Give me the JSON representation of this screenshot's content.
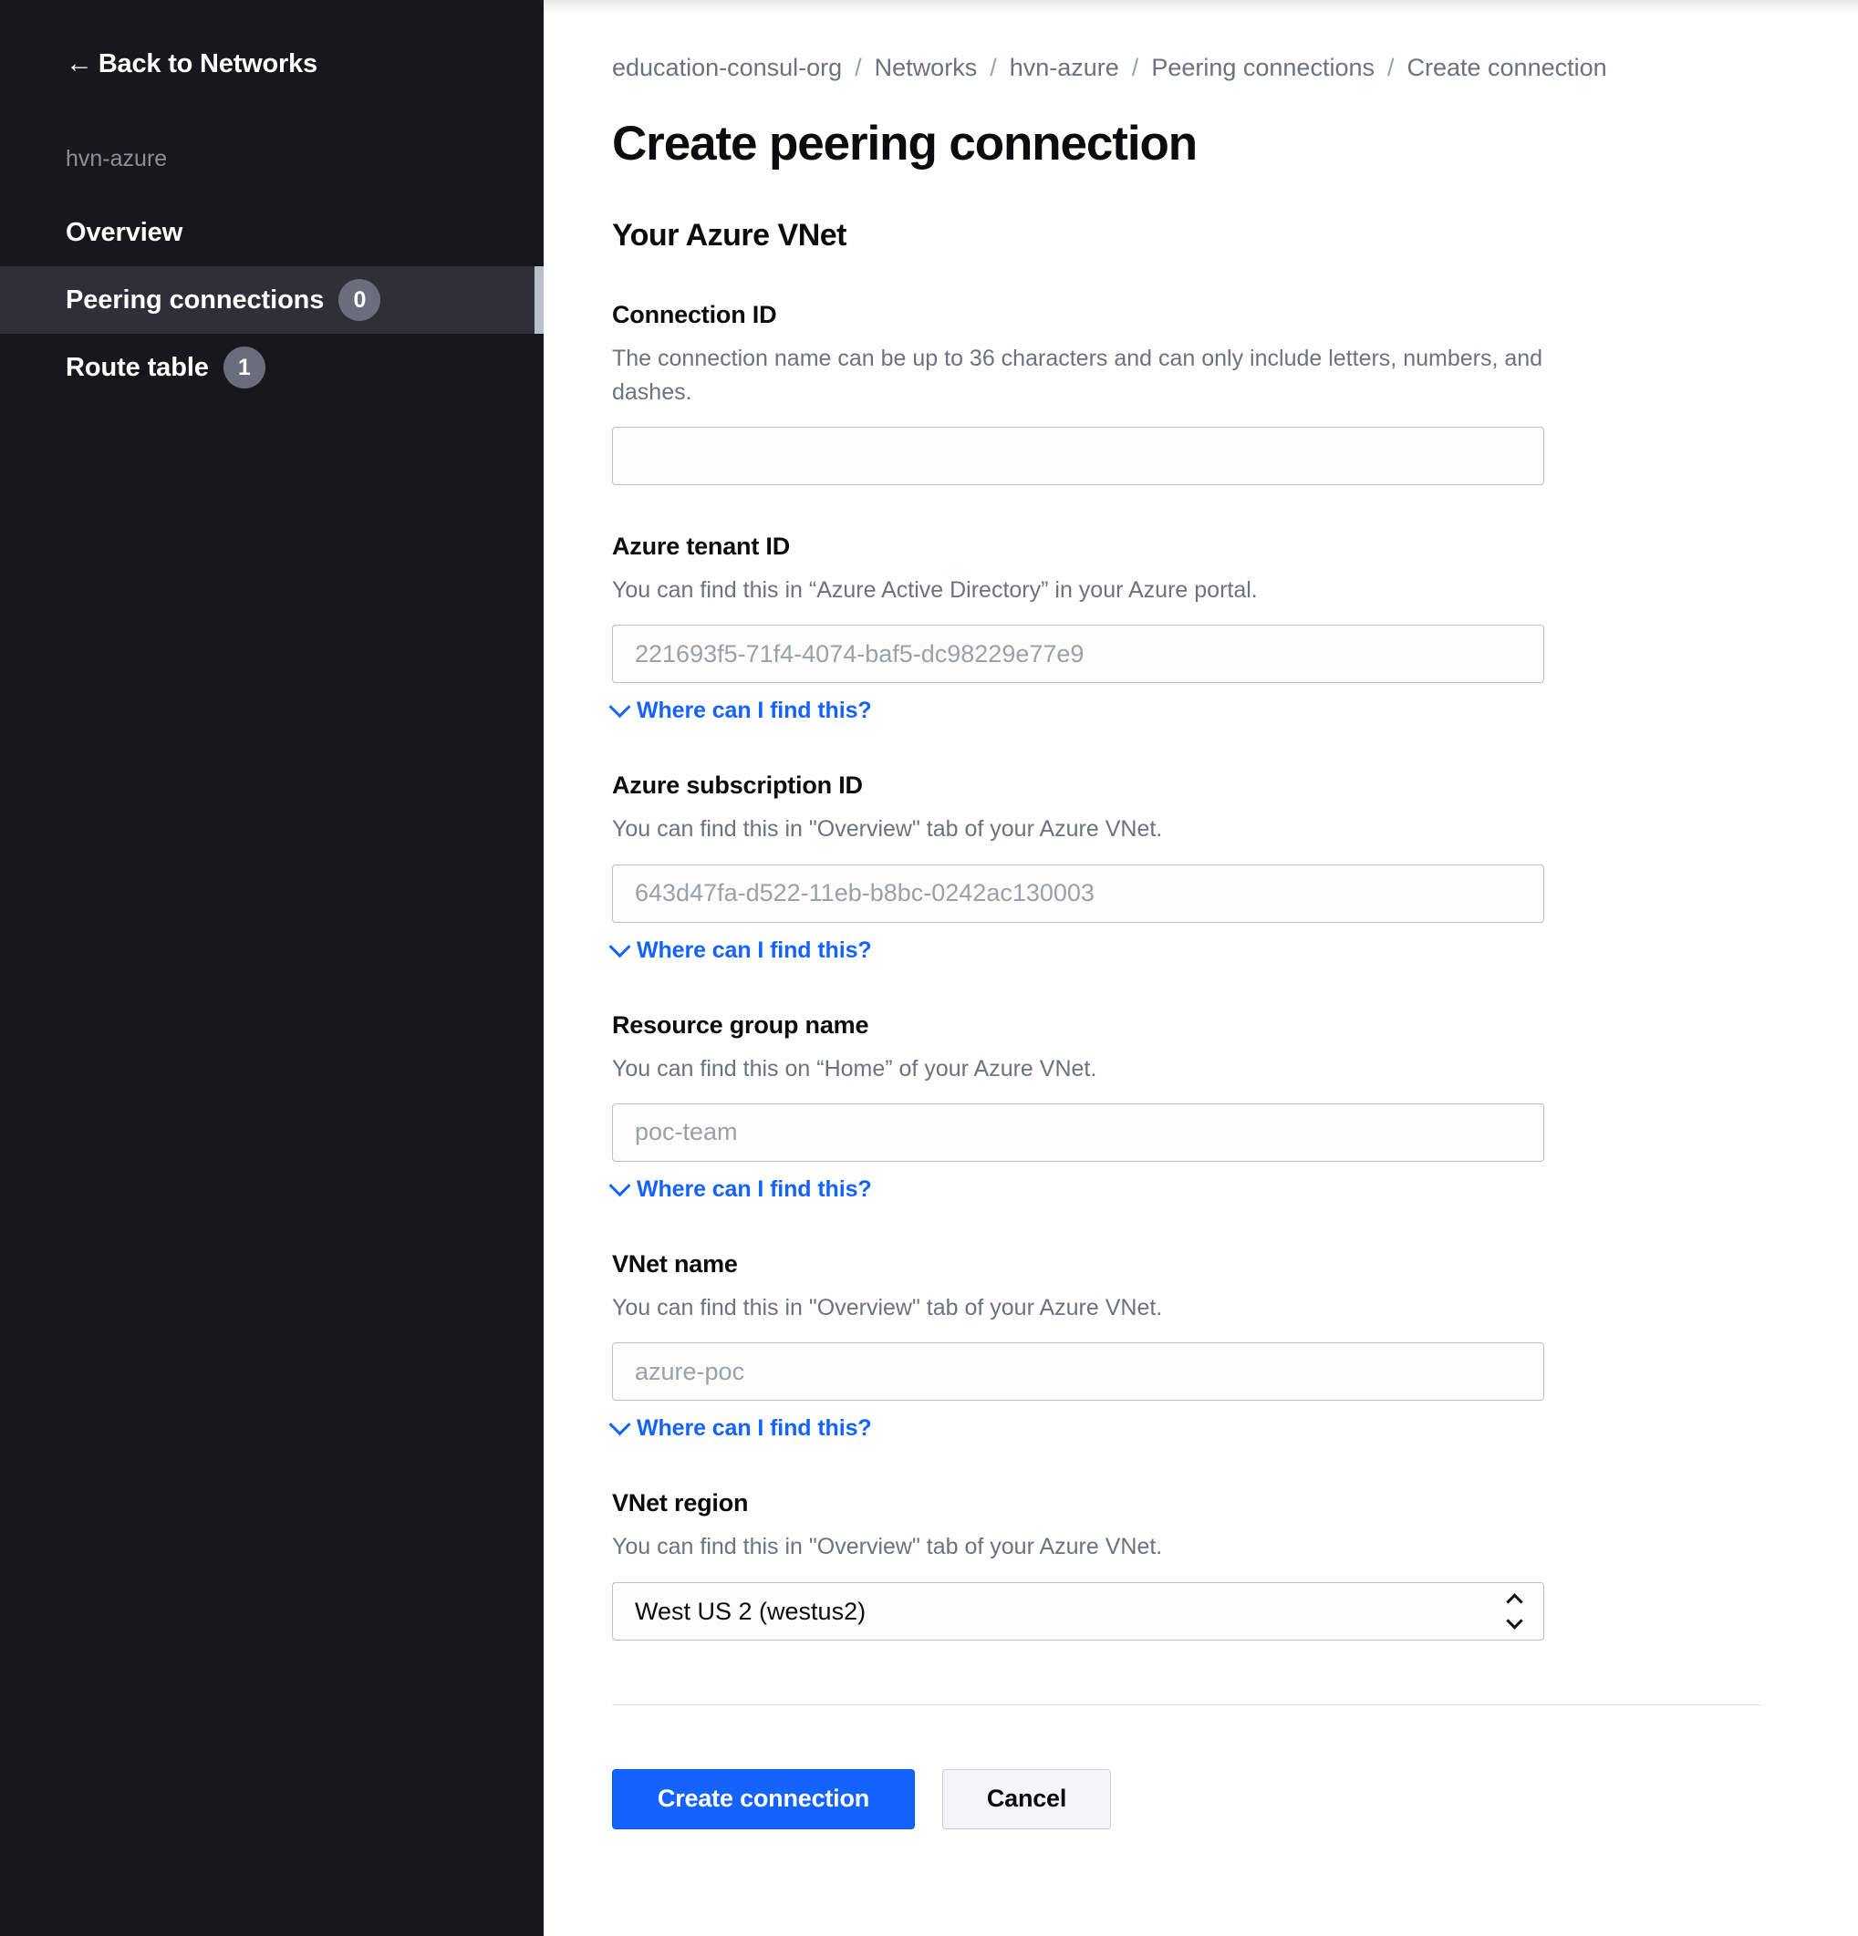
{
  "sidebar": {
    "back_label": "Back to Networks",
    "back_arrow": "←",
    "network_name": "hvn-azure",
    "items": [
      {
        "label": "Overview",
        "badge": null,
        "active": false
      },
      {
        "label": "Peering connections",
        "badge": "0",
        "active": true
      },
      {
        "label": "Route table",
        "badge": "1",
        "active": false
      }
    ]
  },
  "breadcrumb": {
    "separator": "/",
    "items": [
      "education-consul-org",
      "Networks",
      "hvn-azure",
      "Peering connections",
      "Create connection"
    ]
  },
  "page": {
    "title": "Create peering connection",
    "section_title": "Your Azure VNet"
  },
  "fields": {
    "connection_id": {
      "label": "Connection ID",
      "help": "The connection name can be up to 36 characters and can only include letters, numbers, and dashes.",
      "value": "",
      "placeholder": ""
    },
    "tenant_id": {
      "label": "Azure tenant ID",
      "help": "You can find this in “Azure Active Directory” in your Azure portal.",
      "value": "",
      "placeholder": "221693f5-71f4-4074-baf5-dc98229e77e9",
      "find_link": "Where can I find this?"
    },
    "subscription_id": {
      "label": "Azure subscription ID",
      "help": "You can find this in \"Overview\" tab of your Azure VNet.",
      "value": "",
      "placeholder": "643d47fa-d522-11eb-b8bc-0242ac130003",
      "find_link": "Where can I find this?"
    },
    "resource_group": {
      "label": "Resource group name",
      "help": "You can find this on “Home” of your Azure VNet.",
      "value": "",
      "placeholder": "poc-team",
      "find_link": "Where can I find this?"
    },
    "vnet_name": {
      "label": "VNet name",
      "help": "You can find this in \"Overview\" tab of your Azure VNet.",
      "value": "",
      "placeholder": "azure-poc",
      "find_link": "Where can I find this?"
    },
    "vnet_region": {
      "label": "VNet region",
      "help": "You can find this in \"Overview\" tab of your Azure VNet.",
      "selected": "West US 2 (westus2)",
      "options": [
        "West US 2 (westus2)"
      ]
    }
  },
  "actions": {
    "submit_label": "Create connection",
    "cancel_label": "Cancel"
  },
  "colors": {
    "accent_blue": "#1563ff",
    "sidebar_bg": "#16181d",
    "sidebar_active": "#2d3039",
    "badge_bg": "#696e7a",
    "muted_text": "#6b7280"
  }
}
